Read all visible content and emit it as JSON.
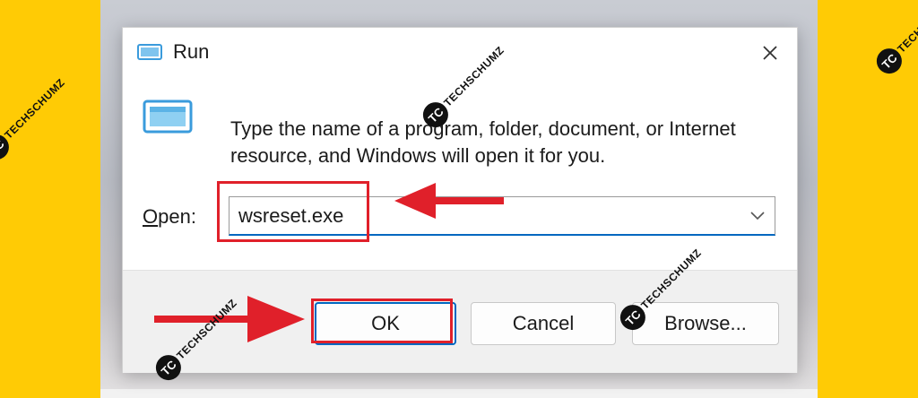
{
  "dialog": {
    "title": "Run",
    "description": "Type the name of a program, folder, document, or Internet resource, and Windows will open it for you.",
    "open_label_accel": "O",
    "open_label_rest": "pen:",
    "open_value": "wsreset.exe"
  },
  "buttons": {
    "ok": "OK",
    "cancel": "Cancel",
    "browse": "Browse..."
  },
  "watermark": {
    "badge": "TC",
    "text": "TECHSCHUMZ"
  },
  "colors": {
    "background": "#FFCB05",
    "highlight": "#E0202A",
    "accent": "#0067C0",
    "icon": "#3A9BDC"
  }
}
